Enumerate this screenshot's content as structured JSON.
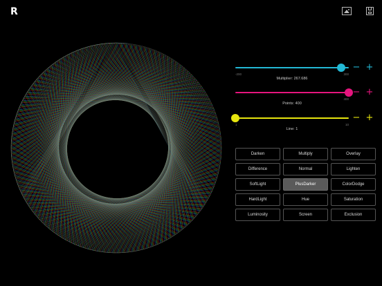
{
  "app": {
    "logo": "R"
  },
  "toolbar": {
    "image_icon": "image-icon",
    "save_icon": "save-icon"
  },
  "sliders": [
    {
      "id": "multiplier",
      "label": "Multiplier: 267.686",
      "min": "-200",
      "max": "300",
      "value": 267.686,
      "min_value": -200,
      "max_value": 300,
      "color": "#23b9d6",
      "minus": "−",
      "plus": "+"
    },
    {
      "id": "points",
      "label": "Points: 400",
      "min": "",
      "max": "400",
      "value": 400,
      "min_value": 0,
      "max_value": 400,
      "color": "#e6157e",
      "minus": "−",
      "plus": "+"
    },
    {
      "id": "line",
      "label": "Line: 1",
      "min": "1",
      "max": "10",
      "value": 1,
      "min_value": 1,
      "max_value": 10,
      "color": "#e7e60e",
      "minus": "−",
      "plus": "+"
    }
  ],
  "blend_modes": [
    {
      "label": "Darken",
      "selected": false
    },
    {
      "label": "Multiply",
      "selected": false
    },
    {
      "label": "Overlay",
      "selected": false
    },
    {
      "label": "Difference",
      "selected": false
    },
    {
      "label": "Normal",
      "selected": false
    },
    {
      "label": "Lighten",
      "selected": false
    },
    {
      "label": "SoftLight",
      "selected": false
    },
    {
      "label": "PlusDarker",
      "selected": true
    },
    {
      "label": "ColorDodge",
      "selected": false
    },
    {
      "label": "HardLight",
      "selected": false
    },
    {
      "label": "Hue",
      "selected": false
    },
    {
      "label": "Saturation",
      "selected": false
    },
    {
      "label": "Luminosity",
      "selected": false
    },
    {
      "label": "Screen",
      "selected": false
    },
    {
      "label": "Exclusion",
      "selected": false
    }
  ]
}
